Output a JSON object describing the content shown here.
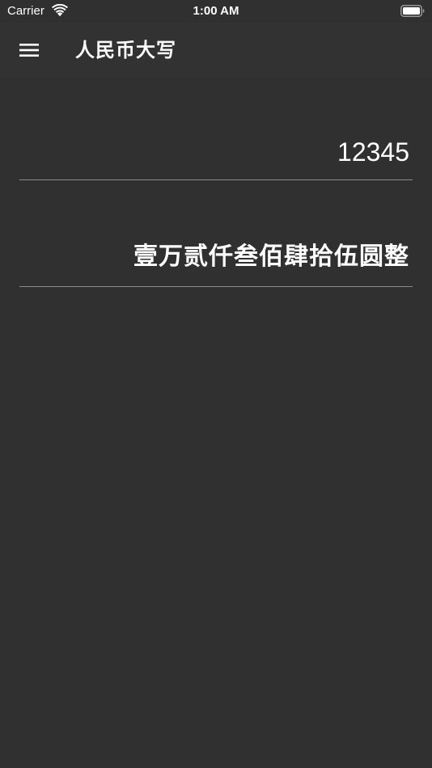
{
  "status_bar": {
    "carrier": "Carrier",
    "time": "1:00 AM",
    "icons": [
      "wifi-icon",
      "battery-icon"
    ]
  },
  "app_bar": {
    "title": "人民币大写",
    "menu_icon": "hamburger-menu-icon"
  },
  "converter": {
    "amount_value": "12345",
    "result_text": "壹万贰仟叁佰肆拾伍圆整"
  },
  "colors": {
    "background": "#303030",
    "app_bar": "#323232",
    "text": "#ffffff",
    "divider": "#8a8a8a"
  }
}
